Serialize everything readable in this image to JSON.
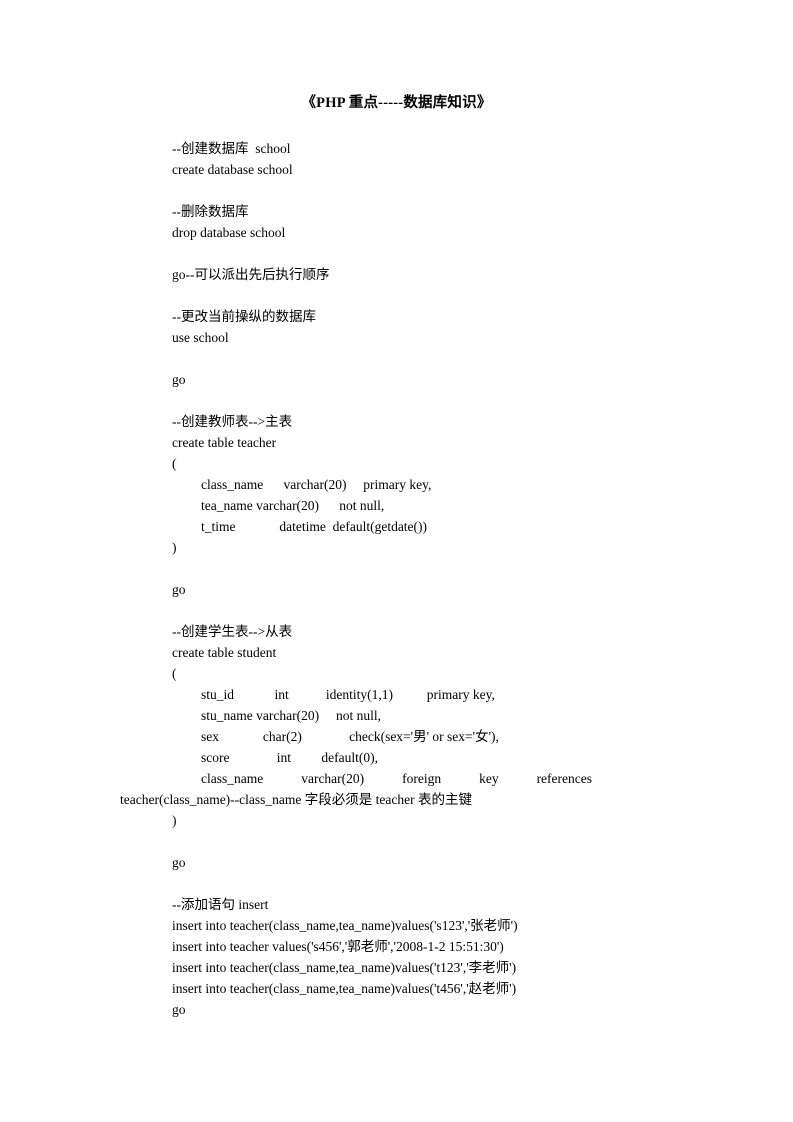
{
  "document": {
    "title": "《PHP 重点-----数据库知识》",
    "lines": [
      {
        "id": "l01",
        "text": "--创建数据库  school",
        "style": "body"
      },
      {
        "id": "l02",
        "text": "create database school",
        "style": "body"
      },
      {
        "id": "l03",
        "text": "",
        "style": "blank"
      },
      {
        "id": "l04",
        "text": "--删除数据库",
        "style": "body"
      },
      {
        "id": "l05",
        "text": "drop database school",
        "style": "body"
      },
      {
        "id": "l06",
        "text": "",
        "style": "blank"
      },
      {
        "id": "l07",
        "text": "go--可以派出先后执行顺序",
        "style": "body"
      },
      {
        "id": "l08",
        "text": "",
        "style": "blank"
      },
      {
        "id": "l09",
        "text": "--更改当前操纵的数据库",
        "style": "body"
      },
      {
        "id": "l10",
        "text": "use school",
        "style": "body"
      },
      {
        "id": "l11",
        "text": "",
        "style": "blank"
      },
      {
        "id": "l12",
        "text": "go",
        "style": "body"
      },
      {
        "id": "l13",
        "text": "",
        "style": "blank"
      },
      {
        "id": "l14",
        "text": "--创建教师表-->主表",
        "style": "body"
      },
      {
        "id": "l15",
        "text": "create table teacher",
        "style": "body"
      },
      {
        "id": "l16",
        "text": "(",
        "style": "body"
      },
      {
        "id": "l17",
        "text": "class_name      varchar(20)     primary key,",
        "style": "col"
      },
      {
        "id": "l18",
        "text": "tea_name varchar(20)      not null,",
        "style": "col"
      },
      {
        "id": "l19",
        "text": "t_time             datetime  default(getdate())",
        "style": "col"
      },
      {
        "id": "l20",
        "text": ")",
        "style": "body"
      },
      {
        "id": "l21",
        "text": "",
        "style": "blank"
      },
      {
        "id": "l22",
        "text": "go",
        "style": "body"
      },
      {
        "id": "l23",
        "text": "",
        "style": "blank"
      },
      {
        "id": "l24",
        "text": "--创建学生表-->从表",
        "style": "body"
      },
      {
        "id": "l25",
        "text": "create table student",
        "style": "body"
      },
      {
        "id": "l26",
        "text": "(",
        "style": "body"
      },
      {
        "id": "l27",
        "text": "stu_id            int           identity(1,1)          primary key,",
        "style": "col"
      },
      {
        "id": "l28",
        "text": "stu_name varchar(20)     not null,",
        "style": "col"
      },
      {
        "id": "l29",
        "text": "sex             char(2)              check(sex='男' or sex='女'),",
        "style": "col"
      },
      {
        "id": "l30",
        "text": "score              int         default(0),",
        "style": "col"
      }
    ],
    "fk_line": {
      "id": "l31",
      "style": "fk-justified",
      "segments": [
        "class_name",
        "varchar(20)",
        "foreign",
        "key",
        "references"
      ],
      "continuation": "teacher(class_name)--class_name 字段必须是 teacher 表的主键"
    },
    "lines_after": [
      {
        "id": "l33",
        "text": ")",
        "style": "body"
      },
      {
        "id": "l34",
        "text": "",
        "style": "blank"
      },
      {
        "id": "l35",
        "text": "go",
        "style": "body"
      },
      {
        "id": "l36",
        "text": "",
        "style": "blank"
      },
      {
        "id": "l37",
        "text": "--添加语句 insert",
        "style": "body"
      },
      {
        "id": "l38",
        "text": "insert into teacher(class_name,tea_name)values('s123','张老师')",
        "style": "body"
      },
      {
        "id": "l39",
        "text": "insert into teacher values('s456','郭老师','2008-1-2 15:51:30')",
        "style": "body"
      },
      {
        "id": "l40",
        "text": "insert into teacher(class_name,tea_name)values('t123','李老师')",
        "style": "body"
      },
      {
        "id": "l41",
        "text": "insert into teacher(class_name,tea_name)values('t456','赵老师')",
        "style": "body"
      },
      {
        "id": "l42",
        "text": "go",
        "style": "body"
      }
    ]
  }
}
